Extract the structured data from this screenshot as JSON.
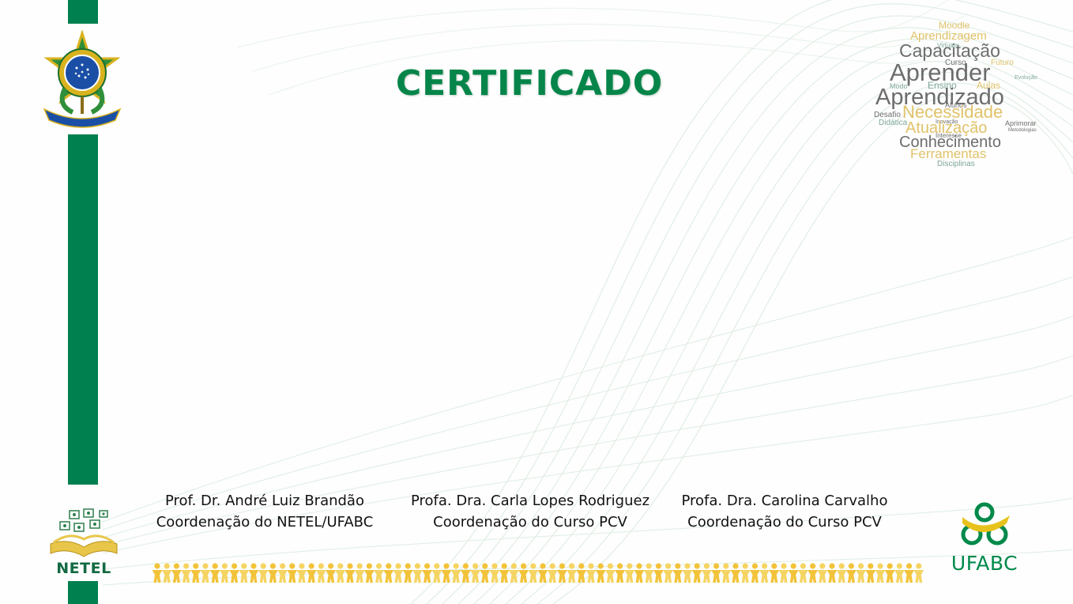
{
  "certificate": {
    "title": "CERTIFICADO"
  },
  "signatures": [
    {
      "name": "Prof. Dr. André Luiz Brandão",
      "role": "Coordenação do NETEL/UFABC"
    },
    {
      "name": "Profa. Dra. Carla Lopes Rodriguez",
      "role": "Coordenação do Curso PCV"
    },
    {
      "name": "Profa. Dra. Carolina Carvalho",
      "role": "Coordenação do Curso PCV"
    }
  ],
  "logos": {
    "netel": "NETEL",
    "ufabc": "UFABC"
  },
  "word_cloud": {
    "words": [
      "Moodle",
      "Aprendizagem",
      "Capacitação",
      "Curso",
      "Futuro",
      "Aprender",
      "Ensino",
      "Aulas",
      "Aprendizado",
      "Alunos",
      "Desafio",
      "Necessidade",
      "Didática",
      "Aprimorar",
      "Atualização",
      "Conhecimento",
      "Ferramentas",
      "Disciplinas",
      "Modo",
      "Virtuais",
      "Evolução",
      "Interesse",
      "Inovação",
      "Metodologias"
    ]
  },
  "colors": {
    "brand_green": "#00804f",
    "title_green": "#058549",
    "gold": "#e8c64a",
    "cloud_grey": "#6d6d6d",
    "cloud_teal": "#7fa79a"
  },
  "icons": {
    "coat_of_arms": "brazil-coat-of-arms-icon",
    "netel": "netel-open-book-icon",
    "ufabc": "ufabc-logo-icon",
    "chain": "people-chain-icon"
  }
}
